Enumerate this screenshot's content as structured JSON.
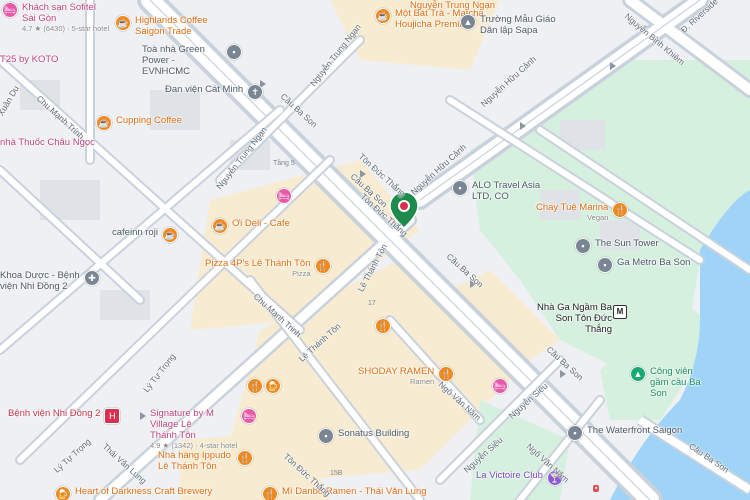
{
  "pois": {
    "khach_san": {
      "name": "Khách sạn Sofitel Sài Gòn",
      "sub": "4.7 ★ (6430) · 5-star hotel"
    },
    "highlands": {
      "name": "Highlands Coffee Saigon Trade"
    },
    "toa_nha": {
      "name": "Toà nhà Green Power - EVNHCMC"
    },
    "mot_bat_tra": {
      "name": "Một Bát Trà - Matcha Houjicha Premium"
    },
    "nguyen_trung_ngan_top": {
      "name": "Nguyễn Trung Ngạn"
    },
    "truong_mau_giao": {
      "name": "Trường Mẫu Giáo Dân lập Sapa"
    },
    "t25": {
      "name": "T25 by KOTO"
    },
    "dan_vien": {
      "name": "Đan viện Cát Minh"
    },
    "nha_thuoc": {
      "name": "nhà Thuốc Châu Ngọc"
    },
    "cupping": {
      "name": "Cupping Coffee"
    },
    "alo_travel": {
      "name": "ALO Travel Asia LTD, CO"
    },
    "chay_tue": {
      "name": "Chay Tuệ Marina",
      "sub": "Vegan"
    },
    "oi_deli": {
      "name": "Ơi Deli - Cafe"
    },
    "cafeinn": {
      "name": "cafeinn roji"
    },
    "sun_tower": {
      "name": "The Sun Tower"
    },
    "ga_metro": {
      "name": "Ga Metro Ba Son"
    },
    "khoa_duoc": {
      "name": "Khoa Dược - Bệnh viện Nhi Đồng 2"
    },
    "pizza_4ps": {
      "name": "Pizza 4P's Lê Thánh Tôn",
      "sub": "Pizza"
    },
    "nha_ga_ngam": {
      "name": "Nhà Ga Ngầm Ba Son Tôn Đức Thắng"
    },
    "shoday": {
      "name": "SHODAY RAMEN",
      "sub": "Ramen"
    },
    "cong_vien": {
      "name": "Công viên gầm cầu Ba Son"
    },
    "benh_vien": {
      "name": "Bệnh viện Nhi Đồng 2"
    },
    "signature": {
      "name": "Signature by M Village Lê Thánh Tôn",
      "sub": "4.9 ★ (1342) · 4-star hotel"
    },
    "sonatus": {
      "name": "Sonatus Building"
    },
    "waterfront": {
      "name": "The Waterfront Saigon"
    },
    "nha_hang": {
      "name": "Nhà hàng Ippudo Lê Thánh Tôn"
    },
    "la_victoire": {
      "name": "La Victoire Club"
    },
    "heart_of_darkness": {
      "name": "Heart of Darkness Craft Brewery"
    },
    "mi_danbo": {
      "name": "Mì Danbo Ramen - Thái Văn Lung"
    }
  },
  "streets": {
    "cau_ba_son_1": "Cầu Ba Son",
    "cau_ba_son_2": "Cầu Ba Son",
    "cau_ba_son_3": "Cầu Ba Son",
    "cau_ba_son_4": "Cầu Ba Son",
    "cau_ba_son_5": "Cầu Ba Son",
    "ton_duc_thang_1": "Tôn Đức Thắng",
    "ton_duc_thang_2": "Tôn Đức Thắng",
    "nguyen_huu_canh_1": "Nguyễn Hữu Cảnh",
    "nguyen_huu_canh_2": "Nguyễn Hữu Cảnh",
    "nguyen_binh_khiem": "Nguyễn Bỉnh Khiêm",
    "d_riverside": "Đ. Riverside",
    "le_thanh_ton_1": "Lê Thánh Tôn",
    "le_thanh_ton_2": "Lê Thánh Tôn",
    "chu_manh_trinh_1": "Chu Mạnh Trinh",
    "chu_manh_trinh_2": "Chu Mạnh Trinh",
    "nguyen_trung_ngan_1": "Nguyễn Trung Ngạn",
    "nguyen_trung_ngan_2": "Nguyễn Trung Ngạn",
    "ly_tu_trong_1": "Lý Tự Trọng",
    "ly_tu_trong_2": "Lý Tự Trọng",
    "thai_van_lung": "Thái Văn Lung",
    "ngo_van_nam_1": "Ngô Văn Năm",
    "ngo_van_nam_2": "Ngô Văn Năm",
    "nguyen_sieu_1": "Nguyễn Siêu",
    "nguyen_sieu_2": "Nguyễn Siêu",
    "ton_duc_thang_lane": "Tôn Đức Thắng",
    "xuan_du": "Xuân Du"
  },
  "blocks": {
    "tang5": "Tầng 5",
    "no17": "17",
    "no15b": "15B"
  },
  "metro_letter": "M",
  "colors": {
    "background": "#eef0f3",
    "park": "#d6f0df",
    "water": "#9fd3f7",
    "road": "#ffffff",
    "major_road": "#c9d2dc",
    "beige": "#f7ecd2",
    "selected_pin": "#1e8a4c"
  },
  "icons": {
    "cafe": "coffee-cup-icon",
    "restaurant": "fork-knife-icon",
    "hotel": "bed-icon",
    "building": "building-icon",
    "metro": "metro-icon",
    "hospital": "hospital-icon",
    "park": "tree-icon",
    "selected": "location-pin-icon"
  }
}
